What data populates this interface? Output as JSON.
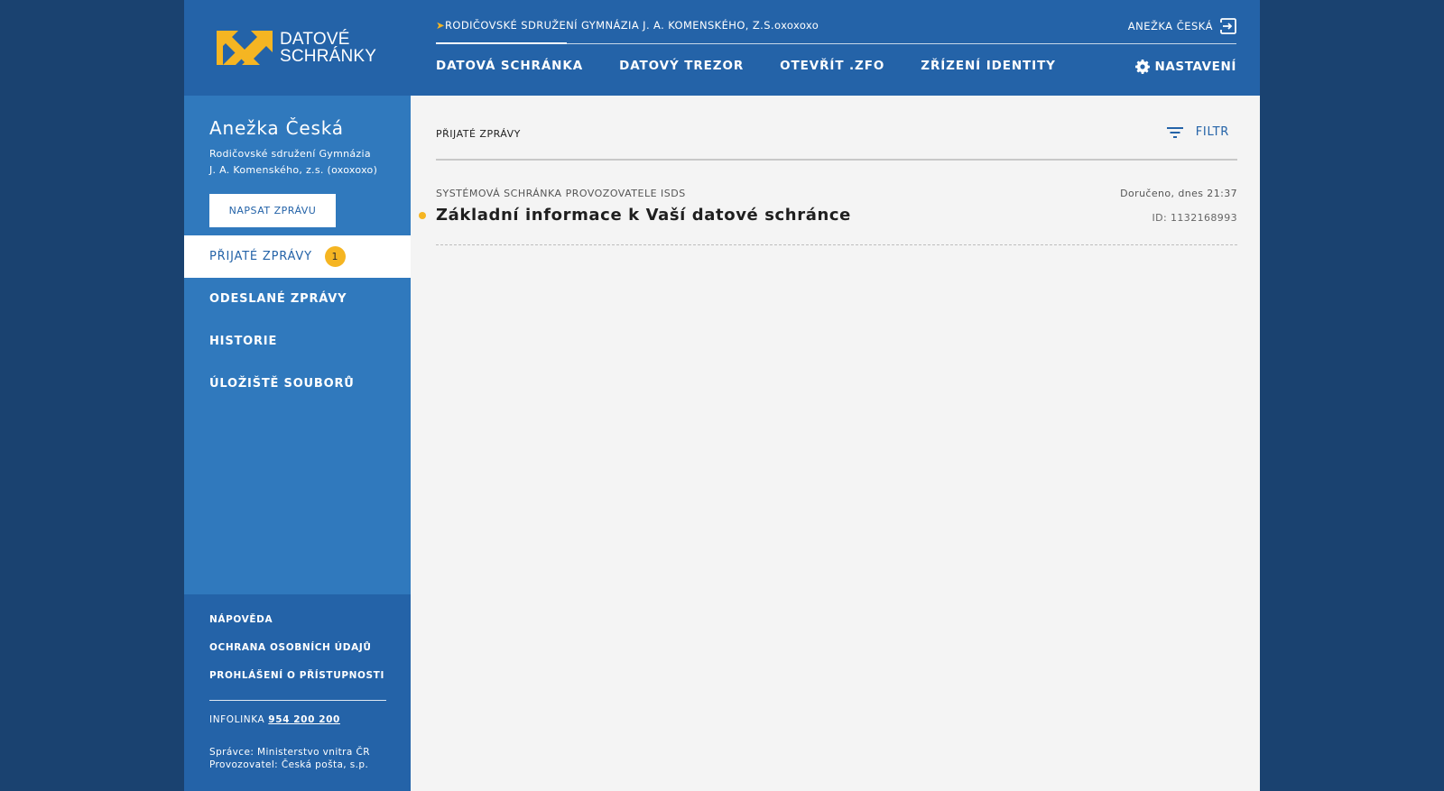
{
  "brand": {
    "logo_line1": "DATOVÉ",
    "logo_line2": "SCHRÁNKY",
    "accent": "#f5b522",
    "primary": "#2463a8"
  },
  "header": {
    "org_arrow": "➤",
    "org_name": "RODIČOVSKÉ SDRUŽENÍ GYMNÁZIA J. A. KOMENSKÉHO, Z.S.oxoxoxo",
    "user_label": "ANEŽKA ČESKÁ",
    "nav": [
      "DATOVÁ SCHRÁNKA",
      "DATOVÝ TREZOR",
      "OTEVŘÍT .ZFO",
      "ZŘÍZENÍ IDENTITY"
    ],
    "settings_label": "NASTAVENÍ"
  },
  "sidebar": {
    "user_name": "Anežka Česká",
    "org_line1": "Rodičovské sdružení Gymnázia",
    "org_line2": "J. A. Komenského, z.s. (oxoxoxo)",
    "write_button": "NAPSAT ZPRÁVU",
    "items": [
      {
        "label": "PŘIJATÉ ZPRÁVY",
        "badge": "1"
      },
      {
        "label": "ODESLANÉ ZPRÁVY"
      },
      {
        "label": "HISTORIE"
      },
      {
        "label": "ÚLOŽIŠTĚ SOUBORŮ"
      }
    ],
    "footer": {
      "links": [
        "NÁPOVĚDA",
        "OCHRANA OSOBNÍCH ÚDAJŮ",
        "PROHLÁŠENÍ O PŘÍSTUPNOSTI"
      ],
      "infolinka_label": "INFOLINKA",
      "infolinka_phone": "954 200 200",
      "credit_line1": "Správce: Ministerstvo vnitra ČR",
      "credit_line2": "Provozovatel: Česká pošta, s.p."
    }
  },
  "content": {
    "title": "PŘIJATÉ ZPRÁVY",
    "filter_label": "FILTR",
    "messages": [
      {
        "sender": "SYSTÉMOVÁ SCHRÁNKA PROVOZOVATELE ISDS",
        "subject": "Základní informace k Vaší datové schránce",
        "date": "Doručeno, dnes 21:37",
        "id": "ID: 1132168993",
        "unread": true
      }
    ]
  }
}
